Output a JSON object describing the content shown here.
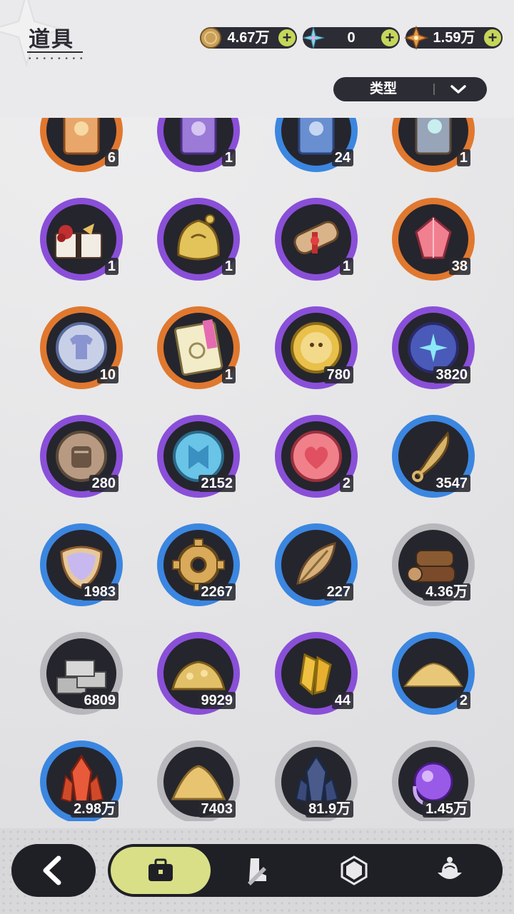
{
  "header": {
    "title": "道具",
    "currencies": [
      {
        "name": "gold-coin",
        "value": "4.67万",
        "plus": "+",
        "color": "#c9a05a"
      },
      {
        "name": "crystal-flower",
        "value": "0",
        "plus": "+",
        "color": "#7fd7e6"
      },
      {
        "name": "star-gem",
        "value": "1.59万",
        "plus": "+",
        "color": "#e29a48"
      }
    ]
  },
  "filter": {
    "label": "类型",
    "icon": "chevron-down-icon"
  },
  "items": [
    {
      "qty": "6",
      "rarity": "orange",
      "icon": "card-orange-icon"
    },
    {
      "qty": "1",
      "rarity": "purple",
      "icon": "card-purple-icon"
    },
    {
      "qty": "24",
      "rarity": "blue",
      "icon": "card-blue-icon"
    },
    {
      "qty": "1",
      "rarity": "orange",
      "icon": "card-moon-icon"
    },
    {
      "qty": "1",
      "rarity": "purple",
      "icon": "gift-box-icon"
    },
    {
      "qty": "1",
      "rarity": "purple",
      "icon": "golden-helmet-icon"
    },
    {
      "qty": "1",
      "rarity": "purple",
      "icon": "scroll-icon"
    },
    {
      "qty": "38",
      "rarity": "orange",
      "icon": "pink-crystal-icon"
    },
    {
      "qty": "10",
      "rarity": "orange",
      "icon": "shirt-coin-icon"
    },
    {
      "qty": "1",
      "rarity": "orange",
      "icon": "ticket-icon"
    },
    {
      "qty": "780",
      "rarity": "purple",
      "icon": "lion-coin-icon"
    },
    {
      "qty": "3820",
      "rarity": "purple",
      "icon": "star-coin-icon"
    },
    {
      "qty": "280",
      "rarity": "purple",
      "icon": "fist-coin-icon"
    },
    {
      "qty": "2152",
      "rarity": "purple",
      "icon": "blue-emblem-coin-icon"
    },
    {
      "qty": "2",
      "rarity": "purple",
      "icon": "heart-coin-icon"
    },
    {
      "qty": "3547",
      "rarity": "blue",
      "icon": "golden-blade-icon"
    },
    {
      "qty": "1983",
      "rarity": "blue",
      "icon": "scale-shield-icon"
    },
    {
      "qty": "2267",
      "rarity": "blue",
      "icon": "gear-icon"
    },
    {
      "qty": "227",
      "rarity": "blue",
      "icon": "leaf-icon"
    },
    {
      "qty": "4.36万",
      "rarity": "grey",
      "icon": "wood-logs-icon"
    },
    {
      "qty": "6809",
      "rarity": "grey",
      "icon": "stone-bricks-icon"
    },
    {
      "qty": "9929",
      "rarity": "purple",
      "icon": "gold-ore-pile-icon"
    },
    {
      "qty": "44",
      "rarity": "purple",
      "icon": "gold-crystal-icon"
    },
    {
      "qty": "2",
      "rarity": "blue",
      "icon": "gold-sand-icon"
    },
    {
      "qty": "2.98万",
      "rarity": "blue",
      "icon": "red-crystal-icon"
    },
    {
      "qty": "7403",
      "rarity": "grey",
      "icon": "sand-pile-icon"
    },
    {
      "qty": "81.9万",
      "rarity": "grey",
      "icon": "dark-crystal-icon"
    },
    {
      "qty": "1.45万",
      "rarity": "grey",
      "icon": "purple-orb-icon"
    }
  ],
  "rarity_colors": {
    "orange": "#e0782f",
    "purple": "#8a4fd8",
    "blue": "#3b86e0",
    "grey": "#b8b8bc"
  },
  "nav": {
    "back_icon": "back-arrow-icon",
    "tabs": [
      {
        "icon": "bag-icon",
        "active": true
      },
      {
        "icon": "boot-sword-icon",
        "active": false
      },
      {
        "icon": "gem-icon",
        "active": false
      },
      {
        "icon": "food-icon",
        "active": false
      }
    ]
  }
}
